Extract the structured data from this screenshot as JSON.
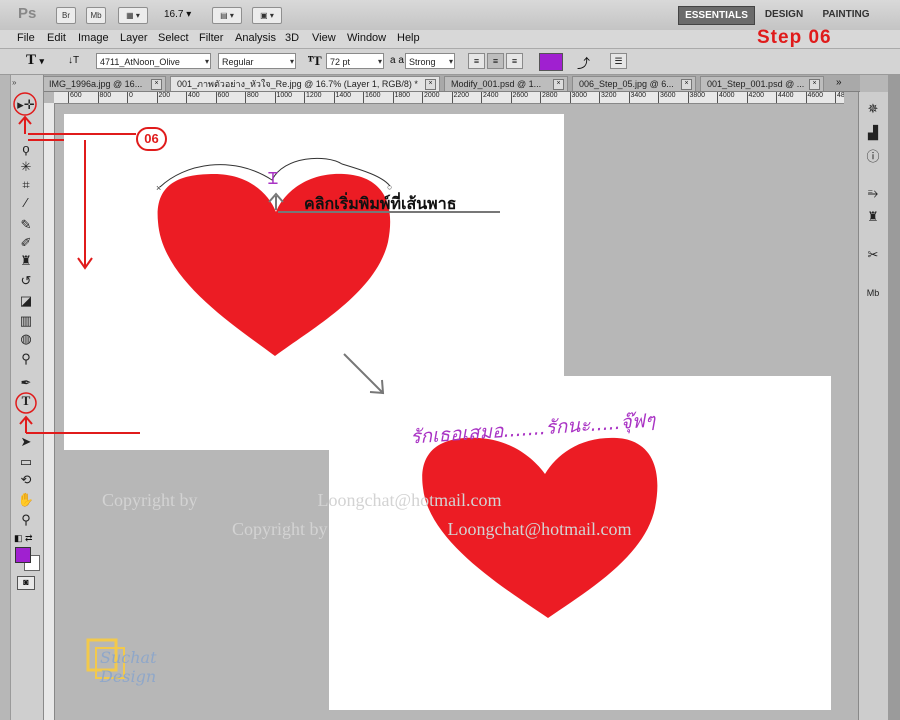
{
  "app": {
    "logo": "Ps",
    "br": "Br",
    "mb": "Mb",
    "zoom": "16.7"
  },
  "workspace": {
    "essentials": "ESSENTIALS",
    "design": "DESIGN",
    "painting": "PAINTING"
  },
  "menu": [
    "File",
    "Edit",
    "Image",
    "Layer",
    "Select",
    "Filter",
    "Analysis",
    "3D",
    "View",
    "Window",
    "Help"
  ],
  "step_label": "Step 06",
  "options": {
    "tool_glyph": "T",
    "orient_glyph": "↓T",
    "font_family": "4711_AtNoon_Olive",
    "font_style": "Regular",
    "font_size": "72 pt",
    "aa_label": "a a",
    "antialias": "Strong",
    "text_color": "#a020d0"
  },
  "tabs": [
    {
      "label": "IMG_1996a.jpg @ 16...",
      "active": false
    },
    {
      "label": "001_ภาพตัวอย่าง_หัวใจ_Re.jpg @ 16.7% (Layer 1, RGB/8) *",
      "active": true
    },
    {
      "label": "Modify_001.psd @ 1...",
      "active": false
    },
    {
      "label": "006_Step_05.jpg @ 6...",
      "active": false
    },
    {
      "label": "001_Step_001.psd @ ...",
      "active": false
    }
  ],
  "ruler_ticks": [
    "600",
    "800",
    "0",
    "200",
    "400",
    "600",
    "800",
    "1000",
    "1200",
    "1400",
    "1600",
    "1800",
    "2000",
    "2200",
    "2400",
    "2600",
    "2800",
    "3000",
    "3200",
    "3400",
    "3600",
    "3800",
    "4000",
    "4200",
    "4400",
    "4600",
    "4800"
  ],
  "annotations": {
    "step_badge": "06",
    "instruction_text": "คลิกเริ่มพิมพ์ที่เส้นพาธ",
    "result_text": "รักเธอเสมอ.......รักนะ.....จุ๊ฟๆ"
  },
  "watermarks": {
    "copyright_1": "Copyright by",
    "email_1": "Loongchat@hotmail.com",
    "copyright_2": "Copyright by",
    "email_2": "Loongchat@hotmail.com",
    "logo_text": "Suchat Design"
  },
  "colors": {
    "heart": "#ec1c24",
    "accent_red": "#e01b1b",
    "purple_text": "#a933c4",
    "foreground_swatch": "#a020d0"
  }
}
